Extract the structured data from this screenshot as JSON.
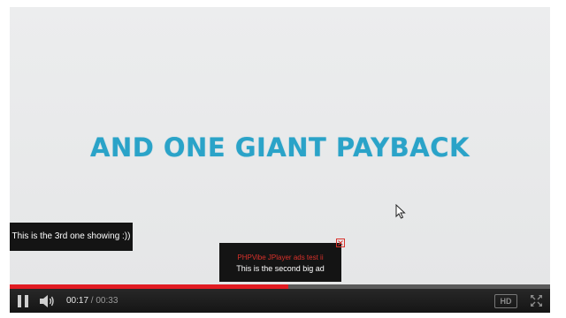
{
  "video": {
    "headline": "AND ONE GIANT PAYBACK",
    "title_color": "#2aa3c8",
    "background_color": "#e9eaeb"
  },
  "ads": {
    "left_banner": "This is the 3rd one showing :))",
    "center_title": "PHPVibe JPlayer ads test ii",
    "center_text": "This is the second big ad",
    "close_icon": "close-icon"
  },
  "controls": {
    "current_time": "00:17",
    "separator": " / ",
    "duration": "00:33",
    "progress_fraction": 0.5152,
    "hd_label": "HD",
    "accent_color": "#e11b22",
    "icons": {
      "pause": "pause-icon",
      "volume": "volume-icon",
      "fullscreen": "fullscreen-icon"
    }
  }
}
